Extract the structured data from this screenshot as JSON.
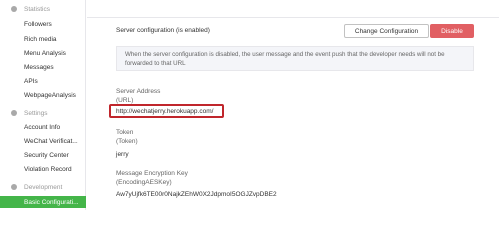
{
  "sidebar": {
    "sections": [
      {
        "title": "Statistics",
        "icon": "statistics-icon",
        "items": [
          {
            "label": "Followers"
          },
          {
            "label": "Rich media"
          },
          {
            "label": "Menu Analysis"
          },
          {
            "label": "Messages"
          },
          {
            "label": "APIs"
          },
          {
            "label": "WebpageAnalysis"
          }
        ]
      },
      {
        "title": "Settings",
        "icon": "settings-icon",
        "items": [
          {
            "label": "Account Info"
          },
          {
            "label": "WeChat Verificat..."
          },
          {
            "label": "Security Center"
          },
          {
            "label": "Violation Record"
          }
        ]
      },
      {
        "title": "Development",
        "icon": "development-icon",
        "items": [
          {
            "label": "Basic Configurati...",
            "active": true
          }
        ]
      }
    ]
  },
  "server_config": {
    "title": "Server configuration (is enabled)",
    "change_button": "Change Configuration",
    "disable_button": "Disable",
    "notice": "When the server configuration is disabled, the user message and the event push that the developer needs will not be forwarded to that URL"
  },
  "fields": {
    "server_address": {
      "label": "Server Address",
      "sublabel": "(URL)",
      "value": "http://wechatjerry.herokuapp.com/"
    },
    "token": {
      "label": "Token",
      "sublabel": "(Token)",
      "value": "jerry"
    },
    "encryption_key": {
      "label": "Message Encryption Key",
      "sublabel": "(EncodingAESKey)",
      "value": "Aw7yUjfk6TE00r0NajkZEhW0X2JdpmoI5OGJZvpDBE2"
    }
  },
  "colors": {
    "accent_green": "#44b549",
    "disable_red": "#e15f63",
    "highlight_box": "#c0262c"
  }
}
